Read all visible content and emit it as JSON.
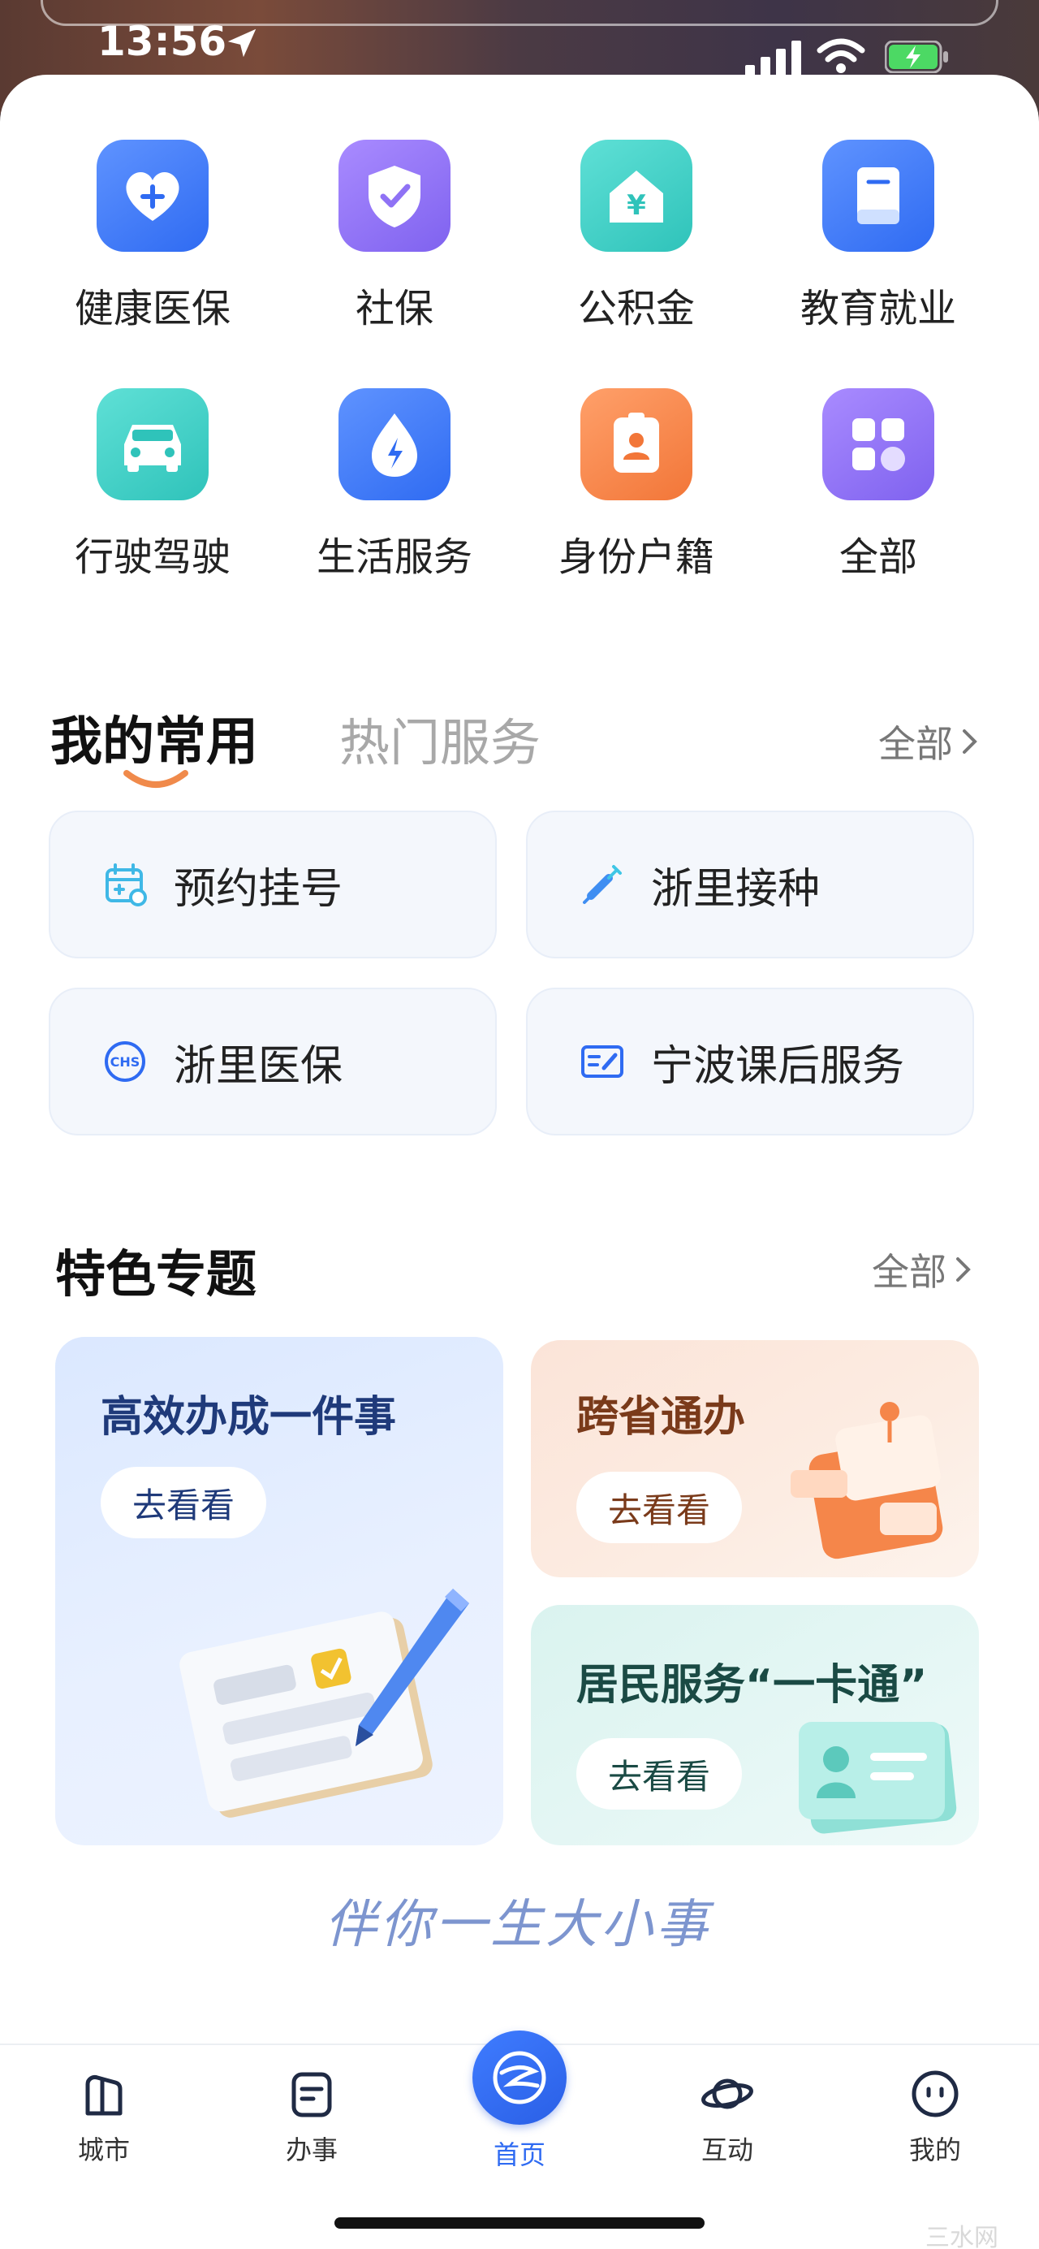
{
  "status_bar": {
    "time": "13:56"
  },
  "categories": [
    {
      "label": "健康医保",
      "icon": "heart-plus-icon",
      "color": "blue"
    },
    {
      "label": "社保",
      "icon": "shield-check-icon",
      "color": "purple"
    },
    {
      "label": "公积金",
      "icon": "house-yen-icon",
      "color": "teal"
    },
    {
      "label": "教育就业",
      "icon": "book-icon",
      "color": "blue"
    },
    {
      "label": "行驶驾驶",
      "icon": "car-icon",
      "color": "teal"
    },
    {
      "label": "生活服务",
      "icon": "water-drop-icon",
      "color": "blue"
    },
    {
      "label": "身份户籍",
      "icon": "id-badge-icon",
      "color": "orange"
    },
    {
      "label": "全部",
      "icon": "grid-icon",
      "color": "purple"
    }
  ],
  "tabs": {
    "active": "我的常用",
    "inactive": "热门服务",
    "more": "全部"
  },
  "services": [
    {
      "label": "预约挂号",
      "icon": "calendar-icon"
    },
    {
      "label": "浙里接种",
      "icon": "syringe-icon"
    },
    {
      "label": "浙里医保",
      "icon": "chs-icon"
    },
    {
      "label": "宁波课后服务",
      "icon": "edit-card-icon"
    }
  ],
  "featured": {
    "title": "特色专题",
    "more": "全部",
    "cards": [
      {
        "title": "高效办成一件事",
        "button": "去看看"
      },
      {
        "title": "跨省通办",
        "button": "去看看"
      },
      {
        "title": "居民服务“一卡通”",
        "button": "去看看"
      }
    ],
    "slogan": "伴你一生大小事"
  },
  "nav": [
    {
      "label": "城市",
      "icon": "city-icon"
    },
    {
      "label": "办事",
      "icon": "affairs-icon"
    },
    {
      "label": "首页",
      "icon": "home-logo-icon",
      "active": true
    },
    {
      "label": "互动",
      "icon": "planet-icon"
    },
    {
      "label": "我的",
      "icon": "face-icon"
    }
  ],
  "colors": {
    "accent": "#2f6bf2",
    "blue": "#3f7cff",
    "purple": "#8f72f5",
    "teal": "#3fd0c6",
    "orange": "#f5864a"
  },
  "watermark": "三水网"
}
